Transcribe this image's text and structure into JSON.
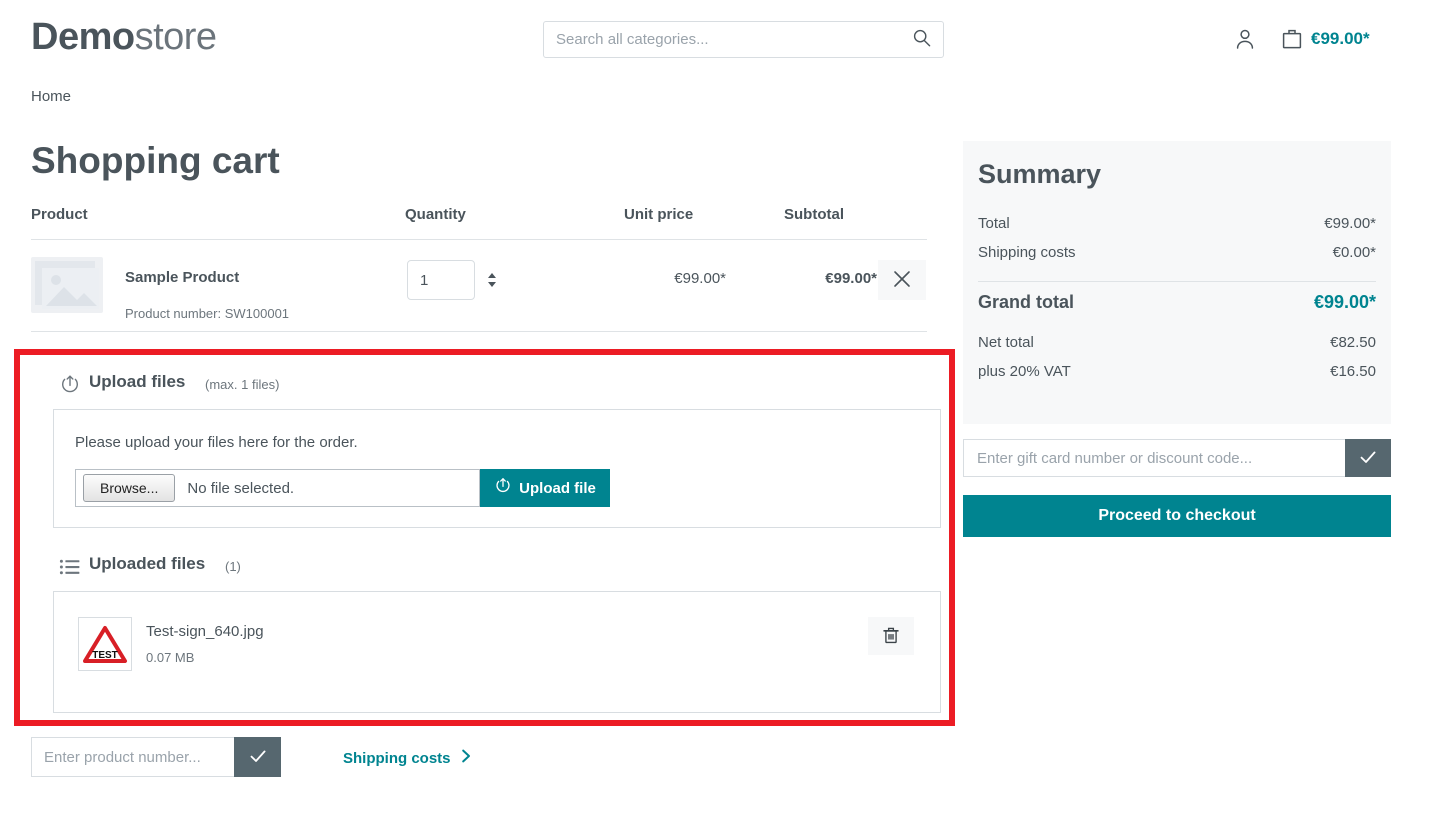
{
  "header": {
    "logo_bold": "Demo",
    "logo_light": "store",
    "search_placeholder": "Search all categories...",
    "search_value": "",
    "search_icon": "search-icon",
    "account_icon": "person-icon",
    "cart_icon": "shopping-bag-icon",
    "cart_amount": "€99.00*"
  },
  "breadcrumb": {
    "home": "Home"
  },
  "page": {
    "title": "Shopping cart"
  },
  "cart": {
    "columns": {
      "product": "Product",
      "quantity": "Quantity",
      "unit_price": "Unit price",
      "subtotal": "Subtotal"
    },
    "rows": [
      {
        "name": "Sample Product",
        "product_number": "Product number: SW100001",
        "quantity": "1",
        "unit_price": "€99.00*",
        "subtotal": "€99.00*",
        "remove_icon": "close-icon"
      }
    ]
  },
  "upload": {
    "section_icon": "upload-circle-icon",
    "title": "Upload files",
    "max_note": "(max. 1 files)",
    "hint": "Please upload your files here for the order.",
    "browse_label": "Browse...",
    "file_status": "No file selected.",
    "upload_button_label": "Upload file",
    "upload_button_icon": "upload-circle-icon"
  },
  "uploaded": {
    "section_icon": "list-icon",
    "title": "Uploaded files",
    "count_note": "(1)",
    "files": [
      {
        "name": "Test-sign_640.jpg",
        "size": "0.07 MB",
        "thumbnail": "warning-triangle-test-icon",
        "thumbnail_label": "TEST",
        "delete_icon": "trash-icon"
      }
    ]
  },
  "bottom": {
    "product_number_placeholder": "Enter product number...",
    "product_number_value": "",
    "submit_icon": "check-icon",
    "shipping_costs_label": "Shipping costs",
    "shipping_chevron_icon": "chevron-right-icon"
  },
  "summary": {
    "title": "Summary",
    "total_label": "Total",
    "total_value": "€99.00*",
    "shipping_label": "Shipping costs",
    "shipping_value": "€0.00*",
    "grand_total_label": "Grand total",
    "grand_total_value": "€99.00*",
    "net_total_label": "Net total",
    "net_total_value": "€82.50",
    "vat_label": "plus 20% VAT",
    "vat_value": "€16.50",
    "giftcard_placeholder": "Enter gift card number or discount code...",
    "giftcard_value": "",
    "giftcard_submit_icon": "check-icon",
    "checkout_label": "Proceed to checkout"
  },
  "colors": {
    "accent_teal": "#008490",
    "text_dark": "#4a545b",
    "highlight_red": "#ec1c24",
    "panel_gray": "#f7f8f9",
    "button_slate": "#56676f"
  }
}
